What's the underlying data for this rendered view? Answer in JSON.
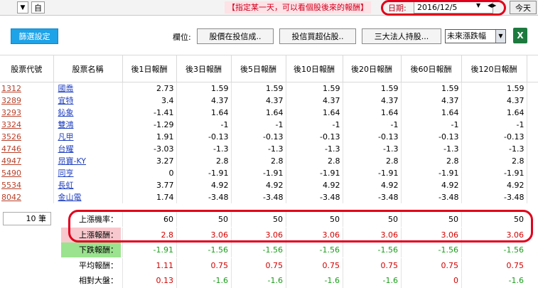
{
  "topbar": {
    "self_label": "自",
    "notice": "【指定某一天，可以看個股後來的報酬】",
    "date_label": "日期:",
    "date_value": "2016/12/5",
    "today_label": "今天"
  },
  "toolbar": {
    "filter_label": "篩選設定",
    "field_label": "欄位:",
    "buttons": [
      "股價在投信成..",
      "投信買超佔股..",
      "三大法人持股..."
    ],
    "select_value": "未來漲跌幅",
    "excel_icon": "excel-icon"
  },
  "table": {
    "headers": [
      "股票代號",
      "股票名稱",
      "後1日報酬",
      "後3日報酬",
      "後5日報酬",
      "後10日報酬",
      "後20日報酬",
      "後60日報酬",
      "後120日報酬"
    ],
    "rows": [
      {
        "code": "1312",
        "name": "國喬",
        "v": [
          "2.73",
          "1.59",
          "1.59",
          "1.59",
          "1.59",
          "1.59",
          "1.59"
        ]
      },
      {
        "code": "3289",
        "name": "宜特",
        "v": [
          "3.4",
          "4.37",
          "4.37",
          "4.37",
          "4.37",
          "4.37",
          "4.37"
        ]
      },
      {
        "code": "3293",
        "name": "鈊象",
        "v": [
          "-1.41",
          "1.64",
          "1.64",
          "1.64",
          "1.64",
          "1.64",
          "1.64"
        ]
      },
      {
        "code": "3324",
        "name": "雙鴻",
        "v": [
          "-1.29",
          "-1",
          "-1",
          "-1",
          "-1",
          "-1",
          "-1"
        ]
      },
      {
        "code": "3526",
        "name": "凡甲",
        "v": [
          "1.91",
          "-0.13",
          "-0.13",
          "-0.13",
          "-0.13",
          "-0.13",
          "-0.13"
        ]
      },
      {
        "code": "4746",
        "name": "台耀",
        "v": [
          "-3.03",
          "-1.3",
          "-1.3",
          "-1.3",
          "-1.3",
          "-1.3",
          "-1.3"
        ]
      },
      {
        "code": "4947",
        "name": "昂寶-KY",
        "v": [
          "3.27",
          "2.8",
          "2.8",
          "2.8",
          "2.8",
          "2.8",
          "2.8"
        ]
      },
      {
        "code": "5490",
        "name": "同亨",
        "v": [
          "0",
          "-1.91",
          "-1.91",
          "-1.91",
          "-1.91",
          "-1.91",
          "-1.91"
        ]
      },
      {
        "code": "5534",
        "name": "長虹",
        "v": [
          "3.77",
          "4.92",
          "4.92",
          "4.92",
          "4.92",
          "4.92",
          "4.92"
        ]
      },
      {
        "code": "8042",
        "name": "金山電",
        "v": [
          "1.74",
          "-3.48",
          "-3.48",
          "-3.48",
          "-3.48",
          "-3.48",
          "-3.48"
        ]
      }
    ]
  },
  "summary": {
    "count": "10 筆",
    "rows": [
      {
        "label": "上漲機率：",
        "values": [
          "60",
          "50",
          "50",
          "50",
          "50",
          "50",
          "50"
        ],
        "color": "#000000",
        "label_bg": "#ffffff"
      },
      {
        "label": "上漲報酬：",
        "values": [
          "2.8",
          "3.06",
          "3.06",
          "3.06",
          "3.06",
          "3.06",
          "3.06"
        ],
        "color": "#d40000",
        "label_bg": "#f7c8cd"
      },
      {
        "label": "下跌報酬：",
        "values": [
          "-1.91",
          "-1.56",
          "-1.56",
          "-1.56",
          "-1.56",
          "-1.56",
          "-1.56"
        ],
        "color": "#1a9c1a",
        "label_bg": "#9be38f"
      },
      {
        "label": "平均報酬：",
        "values": [
          "1.11",
          "0.75",
          "0.75",
          "0.75",
          "0.75",
          "0.75",
          "0.75"
        ],
        "color": "#d40000",
        "label_bg": "#ffffff"
      },
      {
        "label": "相對大盤：",
        "values": [
          "0.13",
          "-1.6",
          "-1.6",
          "-1.6",
          "-1.6",
          "0",
          "-1.6"
        ],
        "color": "#d40000",
        "value_colors": [
          "#d40000",
          "#1a9c1a",
          "#1a9c1a",
          "#1a9c1a",
          "#1a9c1a",
          "#d40000",
          "#1a9c1a"
        ],
        "label_bg": "#ffffff"
      }
    ]
  }
}
